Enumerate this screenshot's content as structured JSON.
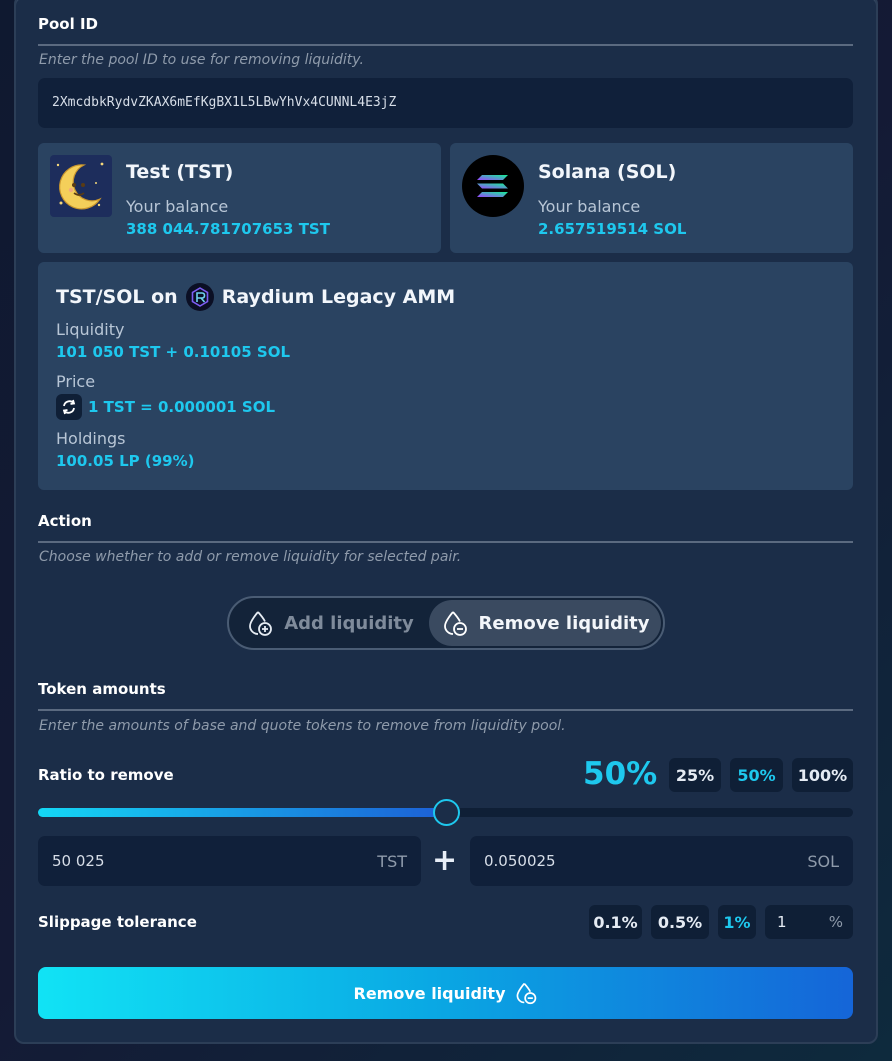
{
  "pool": {
    "title": "Pool ID",
    "hint": "Enter the pool ID to use for removing liquidity.",
    "value": "2XmcdbkRydvZKAX6mEfKgBX1L5LBwYhVx4CUNNL4E3jZ"
  },
  "tokens": {
    "base": {
      "name": "Test (TST)",
      "balance_label": "Your balance",
      "balance": "388 044.781707653 TST",
      "icon": "moon-token-icon"
    },
    "quote": {
      "name": "Solana (SOL)",
      "balance_label": "Your balance",
      "balance": "2.657519514 SOL",
      "icon": "solana-icon"
    }
  },
  "pair_info": {
    "title_prefix": "TST/SOL on",
    "amm_name": "Raydium Legacy AMM",
    "liquidity_label": "Liquidity",
    "liquidity_value": "101 050 TST + 0.10105 SOL",
    "price_label": "Price",
    "price_value": "1 TST = 0.000001 SOL",
    "holdings_label": "Holdings",
    "holdings_value": "100.05 LP (99%)"
  },
  "action": {
    "title": "Action",
    "hint": "Choose whether to add or remove liquidity for selected pair.",
    "add_label": "Add liquidity",
    "remove_label": "Remove liquidity",
    "selected": "remove"
  },
  "amounts": {
    "title": "Token amounts",
    "hint": "Enter the amounts of base and quote tokens to remove from liquidity pool.",
    "ratio_label": "Ratio to remove",
    "ratio_display": "50%",
    "ratio_value": 0.5,
    "presets": [
      "25%",
      "50%",
      "100%"
    ],
    "active_preset": "50%",
    "base_amount": "50 025",
    "base_unit": "TST",
    "quote_amount": "0.050025",
    "quote_unit": "SOL",
    "plus": "+"
  },
  "slippage": {
    "label": "Slippage tolerance",
    "presets": [
      "0.1%",
      "0.5%",
      "1%"
    ],
    "active_preset": "1%",
    "custom_value": "1",
    "custom_unit": "%"
  },
  "submit": {
    "label": "Remove liquidity"
  },
  "colors": {
    "accent": "#1ec8ee",
    "panel": "#1b2d48",
    "card": "#2a4361",
    "input": "#10203a"
  }
}
